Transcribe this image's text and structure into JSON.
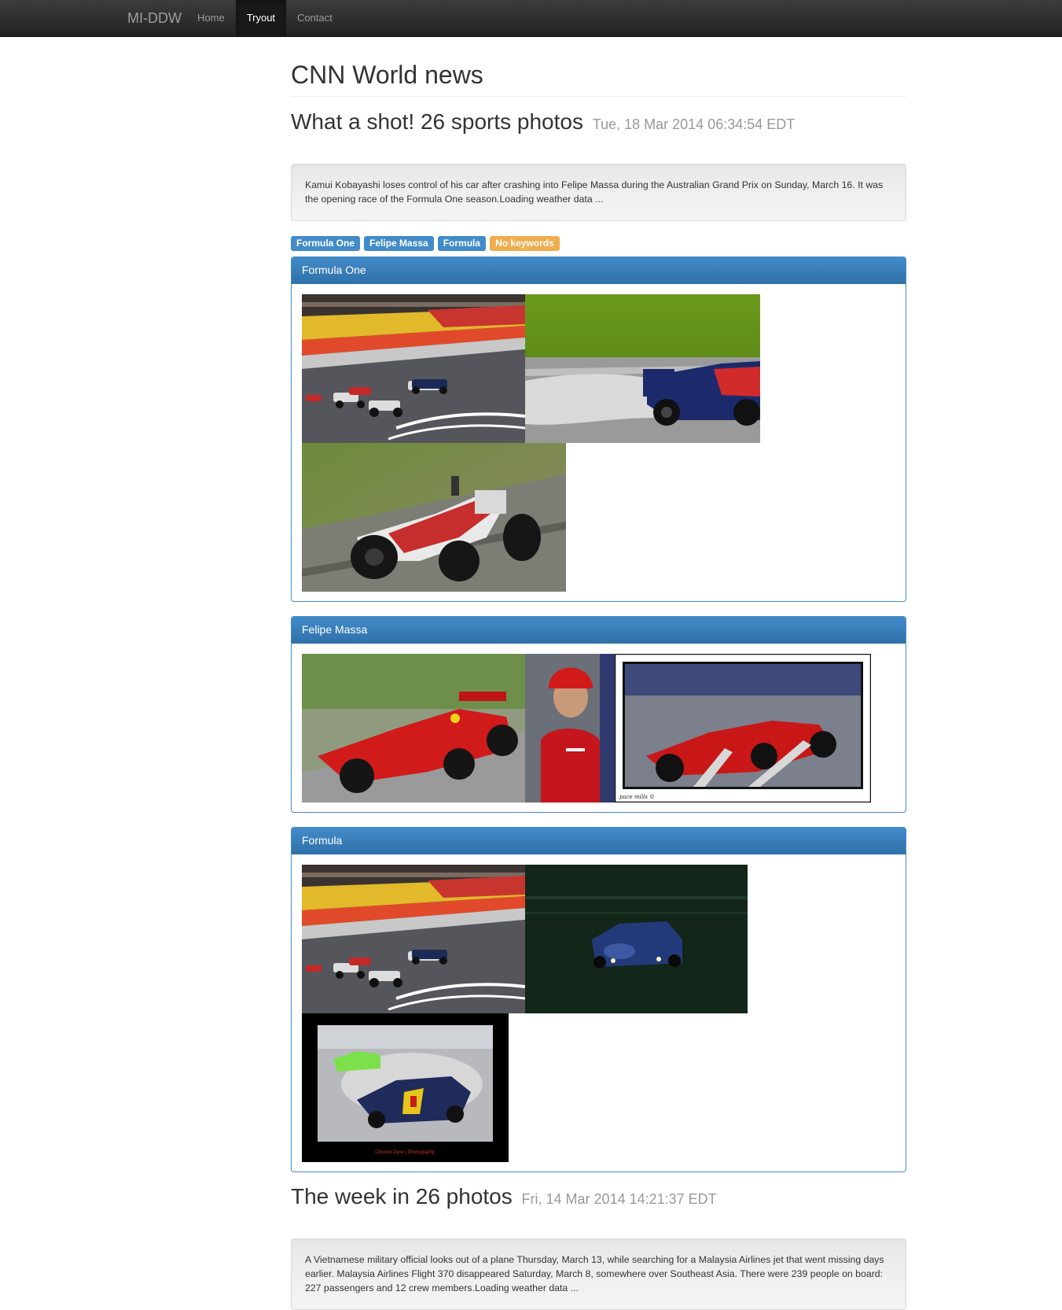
{
  "nav": {
    "brand": "MI-DDW",
    "items": [
      {
        "label": "Home"
      },
      {
        "label": "Tryout"
      },
      {
        "label": "Contact"
      }
    ]
  },
  "page_title": "CNN World news",
  "articles": [
    {
      "title": "What a shot! 26 sports photos",
      "date": "Tue, 18 Mar 2014 06:34:54 EDT",
      "description": "Kamui Kobayashi loses control of his car after crashing into Felipe Massa during the Australian Grand Prix on Sunday, March 16. It was the opening race of the Formula One season.Loading weather data ...",
      "tags": [
        "Formula One",
        "Felipe Massa",
        "Formula",
        "No keywords"
      ],
      "panels": [
        {
          "title": "Formula One"
        },
        {
          "title": "Felipe Massa"
        },
        {
          "title": "Formula"
        }
      ]
    },
    {
      "title": "The week in 26 photos",
      "date": "Fri, 14 Mar 2014 14:21:37 EDT",
      "description": "A Vietnamese military official looks out of a plane Thursday, March 13, while searching for a Malaysia Airlines jet that went missing days earlier. Malaysia Airlines Flight 370 disappeared Saturday, March 8, somewhere over Southeast Asia. There were 239 people on board: 227 passengers and 12 crew members.Loading weather data ..."
    }
  ],
  "photo_watermark": "pace mills ©",
  "photo_credit": "Chrome Zone | Photography",
  "colors": {
    "primary": "#428bca",
    "warning": "#f0ad4e",
    "navbar": "#222222"
  }
}
